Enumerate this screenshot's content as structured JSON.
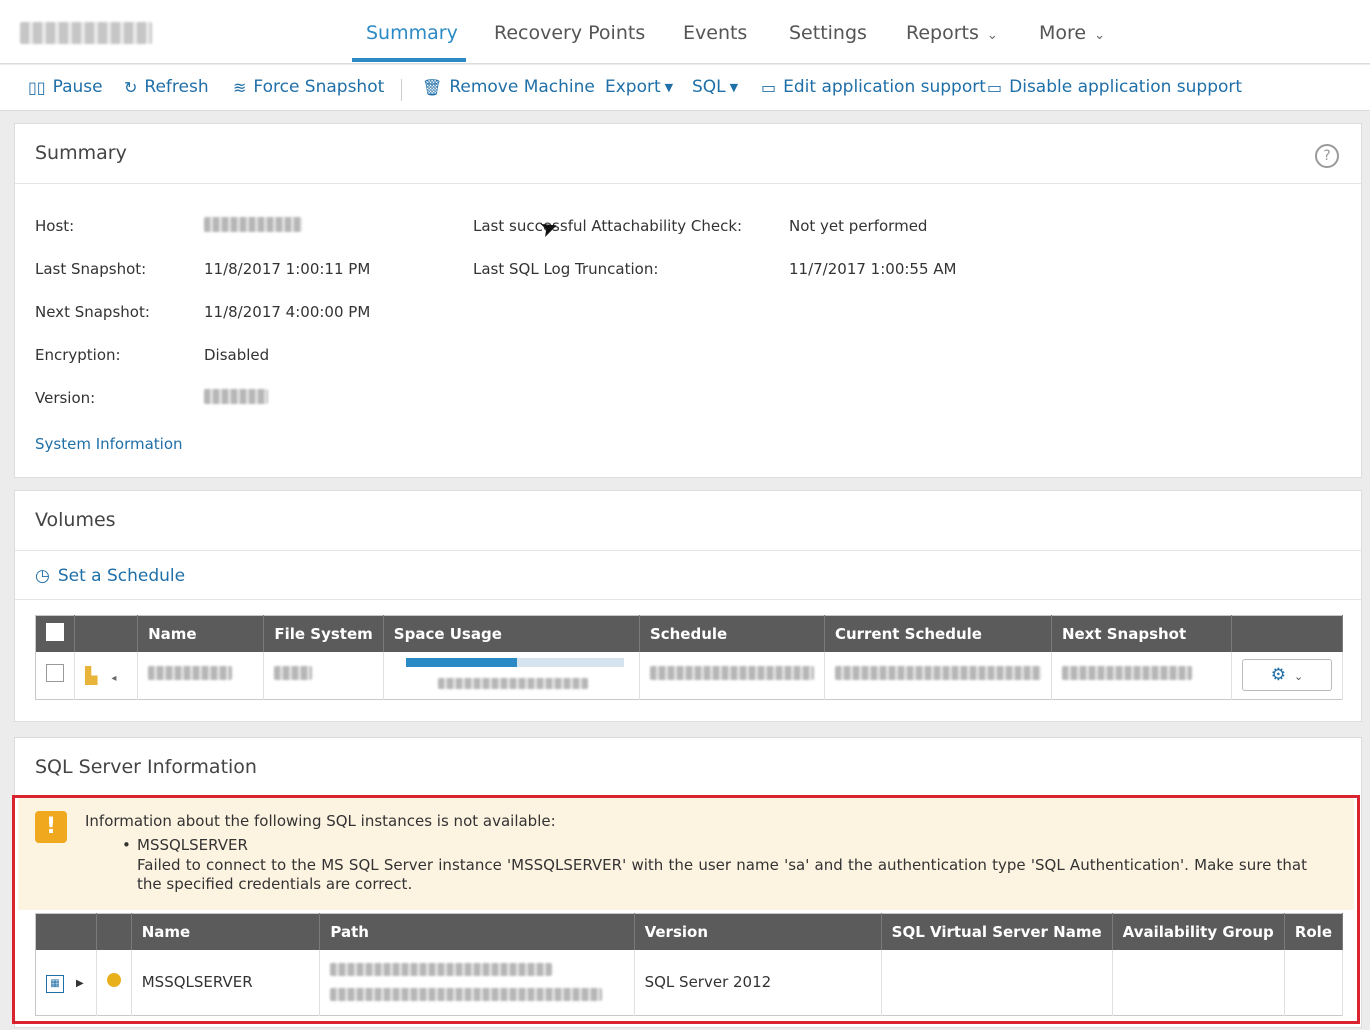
{
  "nav": {
    "tabs": [
      "Summary",
      "Recovery Points",
      "Events",
      "Settings",
      "Reports",
      "More"
    ]
  },
  "toolbar": {
    "pause": "Pause",
    "refresh": "Refresh",
    "force_snapshot": "Force Snapshot",
    "remove_machine": "Remove Machine",
    "export": "Export",
    "sql": "SQL",
    "edit_app_support": "Edit application support",
    "disable_app_support": "Disable application support"
  },
  "summary": {
    "title": "Summary",
    "host_label": "Host:",
    "last_snapshot_label": "Last Snapshot:",
    "last_snapshot_value": "11/8/2017 1:00:11 PM",
    "next_snapshot_label": "Next Snapshot:",
    "next_snapshot_value": "11/8/2017 4:00:00 PM",
    "encryption_label": "Encryption:",
    "encryption_value": "Disabled",
    "version_label": "Version:",
    "attach_label": "Last successful Attachability Check:",
    "attach_value": "Not yet performed",
    "sql_trunc_label": "Last SQL Log Truncation:",
    "sql_trunc_value": "11/7/2017 1:00:55 AM",
    "system_info": "System Information"
  },
  "volumes": {
    "title": "Volumes",
    "set_schedule": "Set a Schedule",
    "columns": [
      "Name",
      "File System",
      "Space Usage",
      "Schedule",
      "Current Schedule",
      "Next Snapshot"
    ],
    "space_usage_fraction": 0.51
  },
  "sql": {
    "title": "SQL Server Information",
    "warning_title": "Information about the following SQL instances is not available:",
    "instance": "MSSQLSERVER",
    "warning_detail": "Failed to connect to the MS SQL Server instance 'MSSQLSERVER' with the user name 'sa' and the authentication type 'SQL Authentication'. Make sure that the specified credentials are correct.",
    "columns": [
      "Name",
      "Path",
      "Version",
      "SQL Virtual Server Name",
      "Availability Group",
      "Role"
    ],
    "row": {
      "name": "MSSQLSERVER",
      "version": "SQL Server 2012"
    }
  }
}
